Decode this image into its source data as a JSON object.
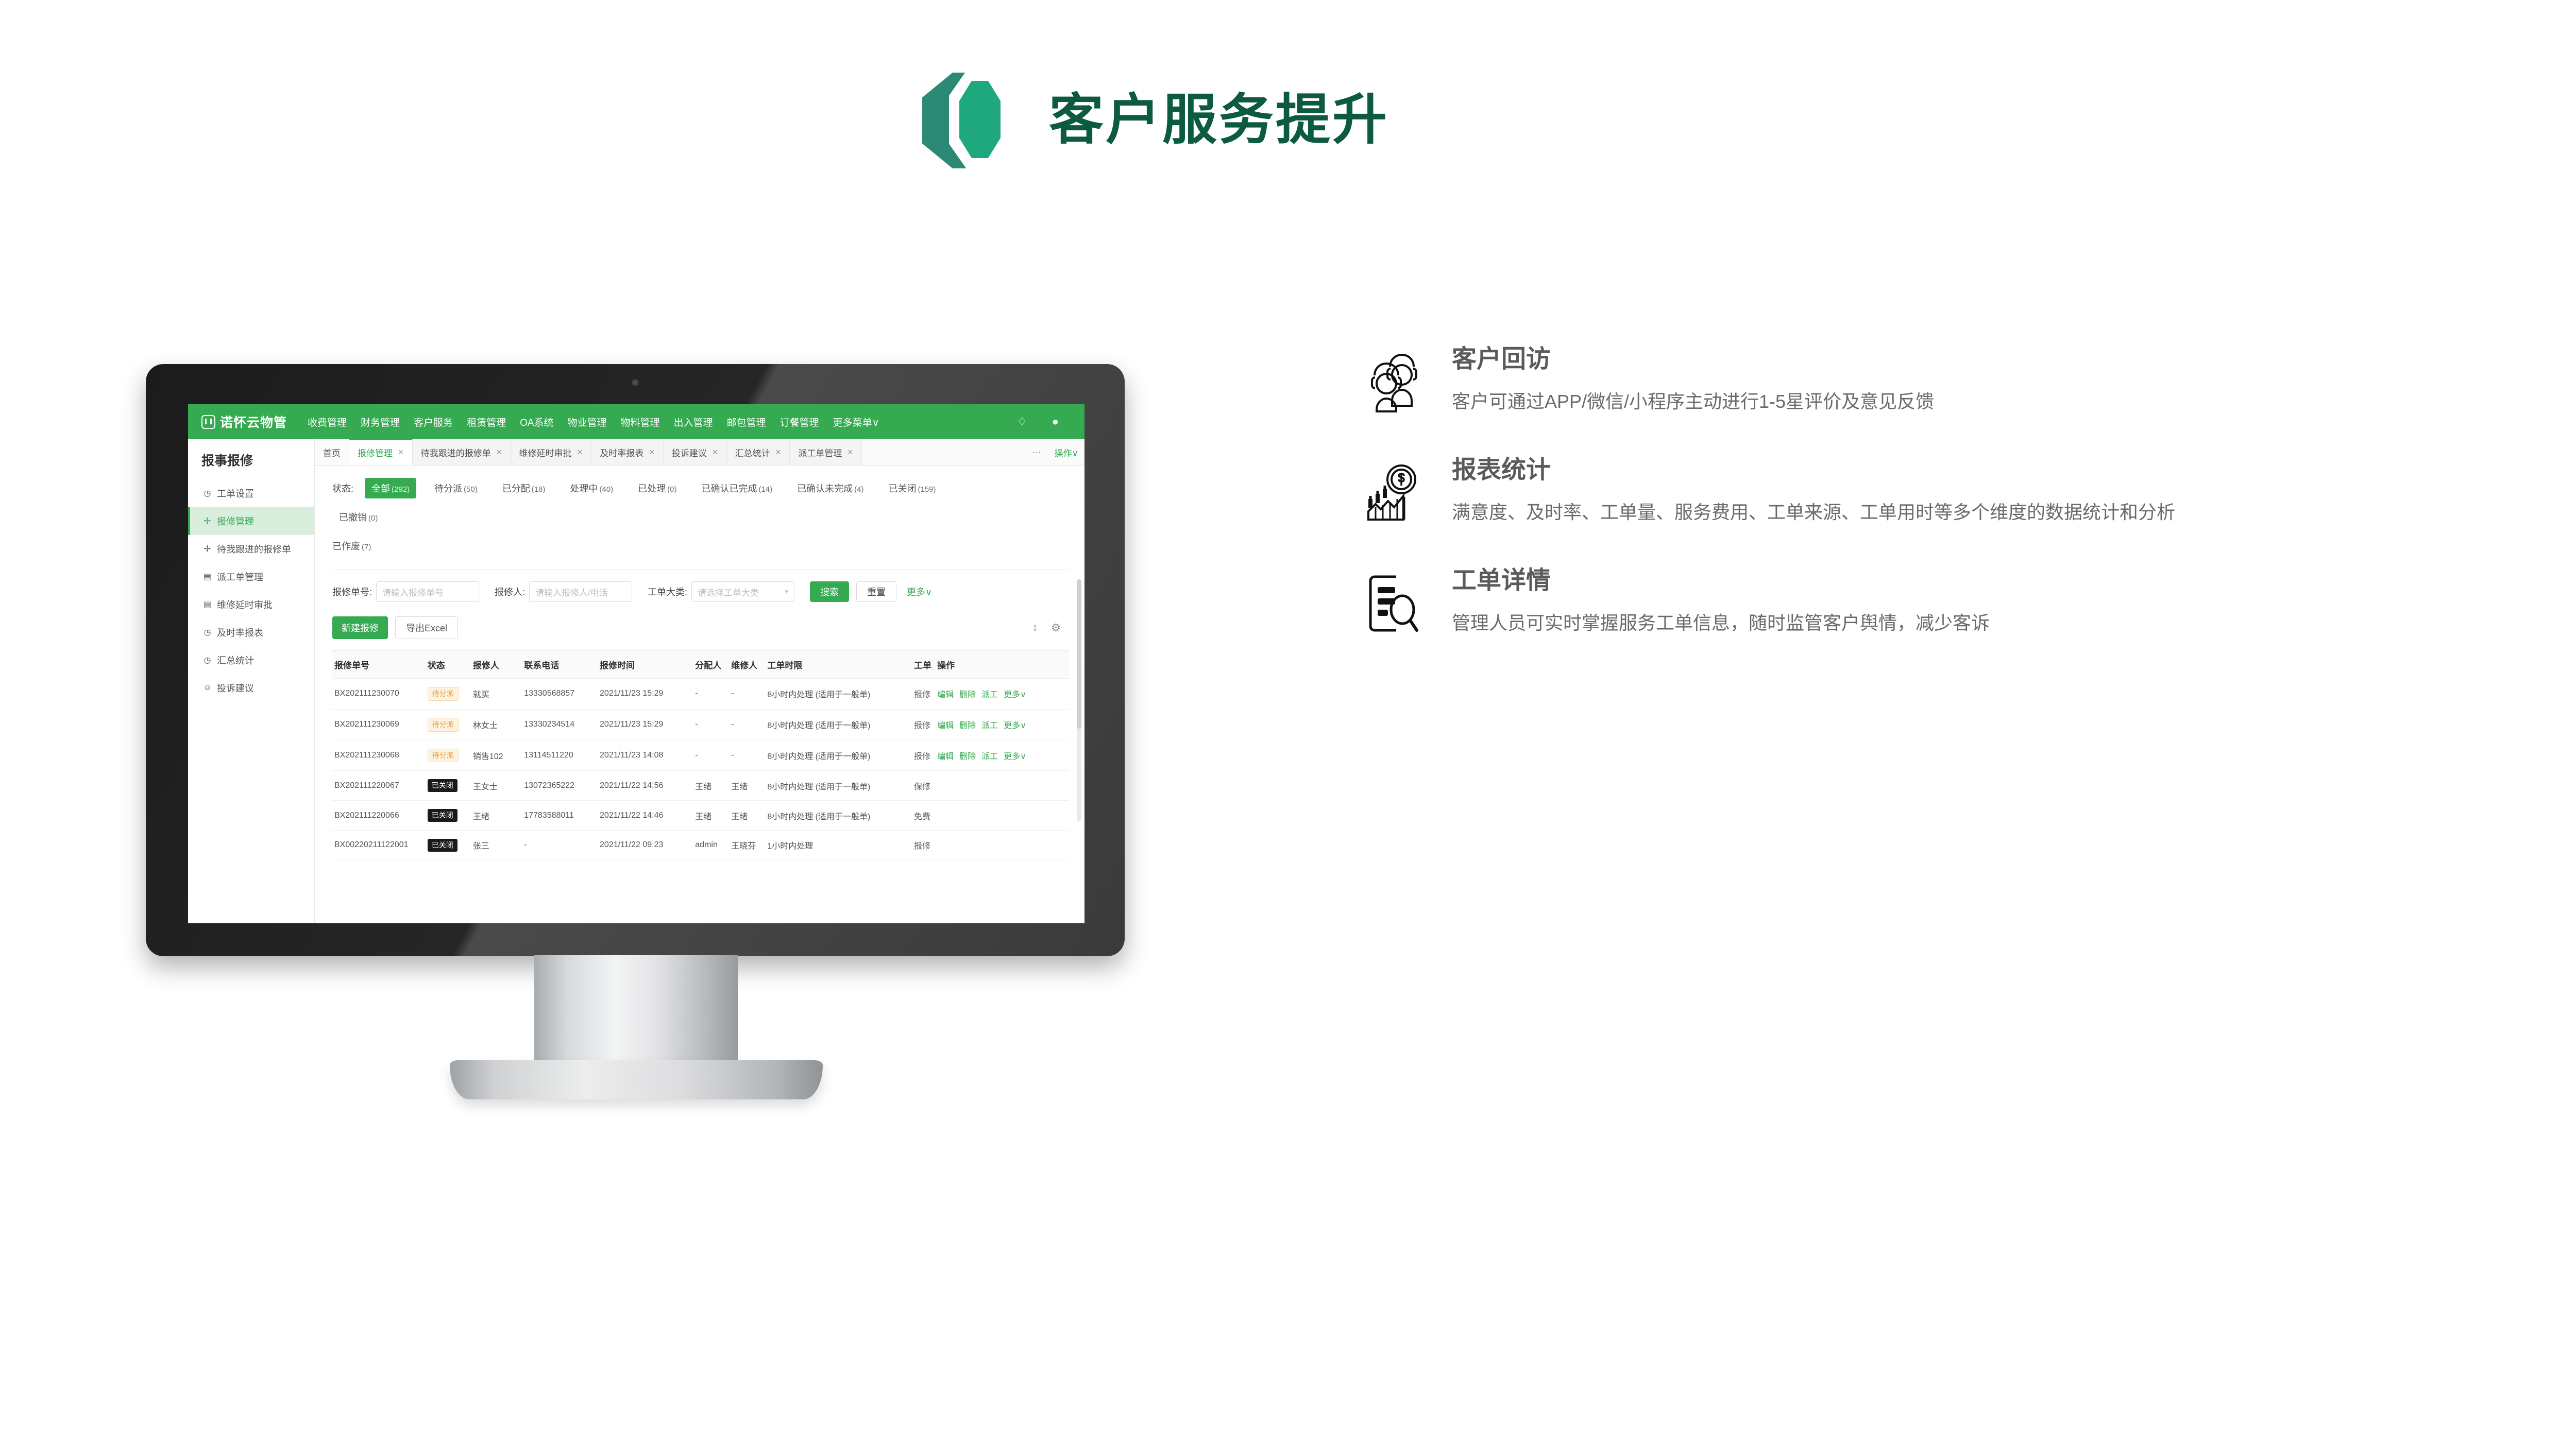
{
  "slide": {
    "title": "客户服务提升",
    "brand_color": "#1fa87e",
    "title_color": "#0c5a42"
  },
  "app": {
    "brand_name": "诺怀云物管",
    "accent_color": "#35aa51",
    "topnav": [
      "收费管理",
      "财务管理",
      "客户服务",
      "租赁管理",
      "OA系统",
      "物业管理",
      "物料管理",
      "出入管理",
      "邮包管理",
      "订餐管理",
      "更多菜单∨"
    ],
    "topnav_icons": [
      "bell-icon",
      "user-icon"
    ],
    "sidebar": {
      "title": "报事报修",
      "items": [
        {
          "label": "工单设置",
          "icon": "clock-icon",
          "active": false
        },
        {
          "label": "报修管理",
          "icon": "wrench-icon",
          "active": true
        },
        {
          "label": "待我跟进的报修单",
          "icon": "wrench-icon",
          "active": false
        },
        {
          "label": "派工单管理",
          "icon": "clipboard-icon",
          "active": false
        },
        {
          "label": "维修延时审批",
          "icon": "clipboard-icon",
          "active": false
        },
        {
          "label": "及时率报表",
          "icon": "clock-icon",
          "active": false
        },
        {
          "label": "汇总统计",
          "icon": "clock-icon",
          "active": false
        },
        {
          "label": "投诉建议",
          "icon": "person-icon",
          "active": false
        }
      ]
    },
    "tabs": [
      {
        "label": "首页",
        "closable": false,
        "active": false
      },
      {
        "label": "报修管理",
        "closable": true,
        "active": true
      },
      {
        "label": "待我跟进的报修单",
        "closable": true,
        "active": false
      },
      {
        "label": "维修延时审批",
        "closable": true,
        "active": false
      },
      {
        "label": "及时率报表",
        "closable": true,
        "active": false
      },
      {
        "label": "投诉建议",
        "closable": true,
        "active": false
      },
      {
        "label": "汇总统计",
        "closable": true,
        "active": false
      },
      {
        "label": "派工单管理",
        "closable": true,
        "active": false
      }
    ],
    "tabstrip_overflow": "···",
    "tabstrip_action": "操作∨",
    "status_filter": {
      "label": "状态:",
      "options": [
        {
          "label": "全部",
          "count": "(292)",
          "selected": true
        },
        {
          "label": "待分派",
          "count": "(50)",
          "selected": false
        },
        {
          "label": "已分配",
          "count": "(18)",
          "selected": false
        },
        {
          "label": "处理中",
          "count": "(40)",
          "selected": false
        },
        {
          "label": "已处理",
          "count": "(0)",
          "selected": false
        },
        {
          "label": "已确认已完成",
          "count": "(14)",
          "selected": false
        },
        {
          "label": "已确认未完成",
          "count": "(4)",
          "selected": false
        },
        {
          "label": "已关闭",
          "count": "(159)",
          "selected": false
        },
        {
          "label": "已撤销",
          "count": "(0)",
          "selected": false
        },
        {
          "label": "已作废",
          "count": "(7)",
          "selected": false
        }
      ]
    },
    "filters": [
      {
        "label": "报修单号:",
        "placeholder": "请输入报修单号",
        "value": "",
        "type": "text"
      },
      {
        "label": "报修人:",
        "placeholder": "请输入报修人/电话",
        "value": "",
        "type": "text"
      },
      {
        "label": "工单大类:",
        "placeholder": "请选择工单大类",
        "value": "",
        "type": "select"
      }
    ],
    "filter_buttons": {
      "search": "搜索",
      "reset": "重置",
      "more": "更多∨"
    },
    "toolbar": {
      "new_label": "新建报修",
      "export_label": "导出Excel",
      "icons": [
        "row-height-icon",
        "gear-icon"
      ]
    },
    "table": {
      "columns": [
        "报修单号",
        "状态",
        "报修人",
        "联系电话",
        "报修时间",
        "分配人",
        "维修人",
        "工单时限",
        "工单",
        "操作"
      ],
      "rows": [
        {
          "id": "BX202111230070",
          "status": "待分派",
          "status_kind": "pending",
          "reporter": "就买",
          "phone": "13330568857",
          "time": "2021/11/23 15:29",
          "assigner": "-",
          "repairer": "-",
          "limit": "8小时内处理 (适用于一般单)",
          "order_type": "报修",
          "ops": [
            "编辑",
            "删除",
            "派工",
            "更多∨"
          ]
        },
        {
          "id": "BX202111230069",
          "status": "待分派",
          "status_kind": "pending",
          "reporter": "林女士",
          "phone": "13330234514",
          "time": "2021/11/23 15:29",
          "assigner": "-",
          "repairer": "-",
          "limit": "8小时内处理 (适用于一般单)",
          "order_type": "报修",
          "ops": [
            "编辑",
            "删除",
            "派工",
            "更多∨"
          ]
        },
        {
          "id": "BX202111230068",
          "status": "待分派",
          "status_kind": "pending",
          "reporter": "销售102",
          "phone": "13114511220",
          "time": "2021/11/23 14:08",
          "assigner": "-",
          "repairer": "-",
          "limit": "8小时内处理 (适用于一般单)",
          "order_type": "报修",
          "ops": [
            "编辑",
            "删除",
            "派工",
            "更多∨"
          ]
        },
        {
          "id": "BX202111220067",
          "status": "已关闭",
          "status_kind": "closed",
          "reporter": "王女士",
          "phone": "13072365222",
          "time": "2021/11/22 14:56",
          "assigner": "王绪",
          "repairer": "王绪",
          "limit": "8小时内处理 (适用于一般单)",
          "order_type": "保修",
          "ops": []
        },
        {
          "id": "BX202111220066",
          "status": "已关闭",
          "status_kind": "closed",
          "reporter": "王绪",
          "phone": "17783588011",
          "time": "2021/11/22 14:46",
          "assigner": "王绪",
          "repairer": "王绪",
          "limit": "8小时内处理 (适用于一般单)",
          "order_type": "免费",
          "ops": []
        },
        {
          "id": "BX00220211122001",
          "status": "已关闭",
          "status_kind": "closed",
          "reporter": "张三",
          "phone": "-",
          "time": "2021/11/22 09:23",
          "assigner": "admin",
          "repairer": "王晓芬",
          "limit": "1小时内处理",
          "order_type": "报修",
          "ops": []
        }
      ]
    }
  },
  "features": [
    {
      "icon": "customer-headset-icon",
      "title": "客户回访",
      "desc": "客户可通过APP/微信/小程序主动进行1-5星评价及意见反馈"
    },
    {
      "icon": "chart-money-icon",
      "title": "报表统计",
      "desc": "满意度、及时率、工单量、服务费用、工单来源、工单用时等多个维度的数据统计和分析"
    },
    {
      "icon": "document-search-icon",
      "title": "工单详情",
      "desc": "管理人员可实时掌握服务工单信息，随时监管客户舆情，减少客诉"
    }
  ]
}
